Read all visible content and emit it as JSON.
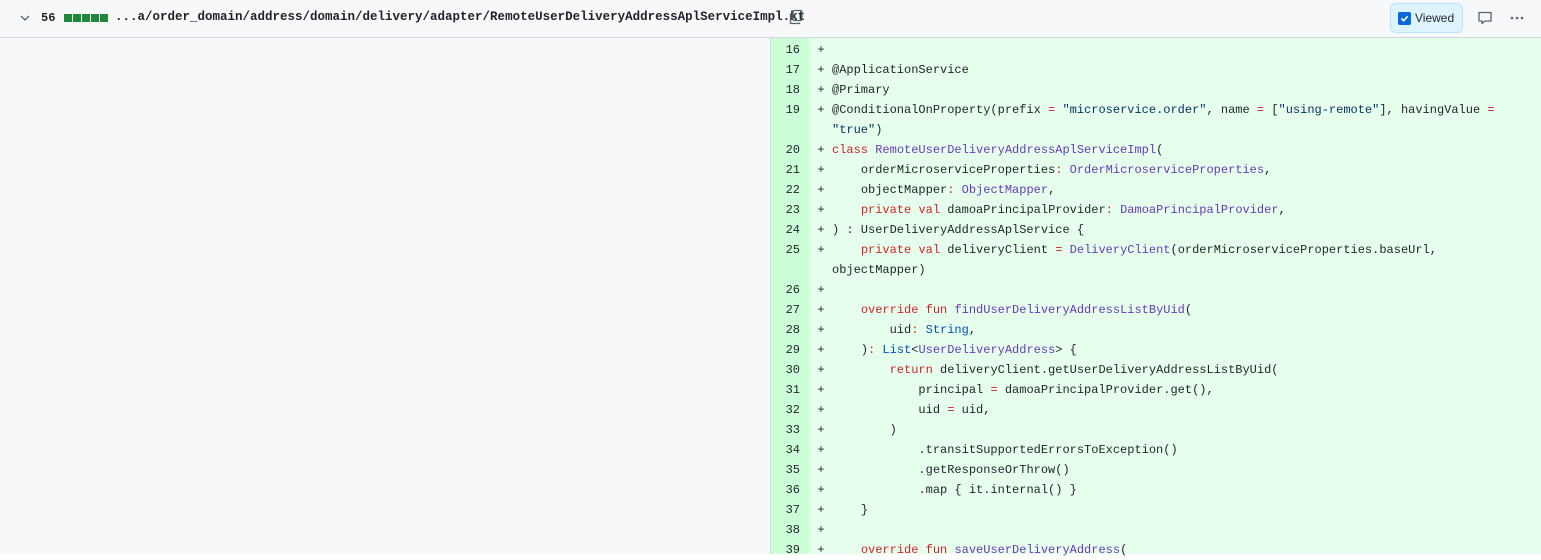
{
  "file_header": {
    "changes_count": "56",
    "file_path": "...a/order_domain/address/domain/delivery/adapter/RemoteUserDeliveryAddressAplServiceImpl.kt",
    "viewed_label": "Viewed",
    "viewed_checked": true,
    "diffstat_added_blocks": 5
  },
  "colors": {
    "added_bg": "#e6ffec",
    "added_gutter": "#ccffd8",
    "keyword": "#cf222e",
    "type": "#6639ba",
    "string": "#0a3069",
    "builtin": "#0550ae"
  },
  "diff_lines": [
    {
      "num": "16",
      "sign": "+",
      "tokens": []
    },
    {
      "num": "17",
      "sign": "+",
      "tokens": [
        [
          "@ApplicationService",
          ""
        ]
      ]
    },
    {
      "num": "18",
      "sign": "+",
      "tokens": [
        [
          "@Primary",
          ""
        ]
      ]
    },
    {
      "num": "19",
      "sign": "+",
      "tokens": [
        [
          "@ConditionalOnProperty(prefix ",
          ""
        ],
        [
          "=",
          "k"
        ],
        [
          " ",
          ""
        ],
        [
          "\"microservice.order\"",
          "s"
        ],
        [
          ", name ",
          ""
        ],
        [
          "=",
          "k"
        ],
        [
          " [",
          ""
        ],
        [
          "\"using-remote\"",
          "s"
        ],
        [
          "], havingValue ",
          ""
        ],
        [
          "=",
          "k"
        ],
        [
          " ",
          ""
        ],
        [
          "\"true\"",
          "s"
        ],
        [
          ")",
          ""
        ]
      ]
    },
    {
      "num": "20",
      "sign": "+",
      "tokens": [
        [
          "class",
          "k"
        ],
        [
          " ",
          ""
        ],
        [
          "RemoteUserDeliveryAddressAplServiceImpl",
          "t"
        ],
        [
          "(",
          ""
        ]
      ]
    },
    {
      "num": "21",
      "sign": "+",
      "tokens": [
        [
          "    orderMicroserviceProperties",
          ""
        ],
        [
          ":",
          "k"
        ],
        [
          " ",
          ""
        ],
        [
          "OrderMicroserviceProperties",
          "t"
        ],
        [
          ",",
          ""
        ]
      ]
    },
    {
      "num": "22",
      "sign": "+",
      "tokens": [
        [
          "    objectMapper",
          ""
        ],
        [
          ":",
          "k"
        ],
        [
          " ",
          ""
        ],
        [
          "ObjectMapper",
          "t"
        ],
        [
          ",",
          ""
        ]
      ]
    },
    {
      "num": "23",
      "sign": "+",
      "tokens": [
        [
          "    ",
          ""
        ],
        [
          "private",
          "k"
        ],
        [
          " ",
          ""
        ],
        [
          "val",
          "k"
        ],
        [
          " damoaPrincipalProvider",
          ""
        ],
        [
          ":",
          "k"
        ],
        [
          " ",
          ""
        ],
        [
          "DamoaPrincipalProvider",
          "t"
        ],
        [
          ",",
          ""
        ]
      ]
    },
    {
      "num": "24",
      "sign": "+",
      "tokens": [
        [
          ") : UserDeliveryAddressAplService {",
          ""
        ]
      ]
    },
    {
      "num": "25",
      "sign": "+",
      "tokens": [
        [
          "    ",
          ""
        ],
        [
          "private",
          "k"
        ],
        [
          " ",
          ""
        ],
        [
          "val",
          "k"
        ],
        [
          " deliveryClient ",
          ""
        ],
        [
          "=",
          "k"
        ],
        [
          " ",
          ""
        ],
        [
          "DeliveryClient",
          "t"
        ],
        [
          "(orderMicroserviceProperties.baseUrl, objectMapper)",
          ""
        ]
      ]
    },
    {
      "num": "26",
      "sign": "+",
      "tokens": []
    },
    {
      "num": "27",
      "sign": "+",
      "tokens": [
        [
          "    ",
          ""
        ],
        [
          "override",
          "k"
        ],
        [
          " ",
          ""
        ],
        [
          "fun",
          "k"
        ],
        [
          " ",
          ""
        ],
        [
          "findUserDeliveryAddressListByUid",
          "t"
        ],
        [
          "(",
          ""
        ]
      ]
    },
    {
      "num": "28",
      "sign": "+",
      "tokens": [
        [
          "        uid",
          ""
        ],
        [
          ":",
          "k"
        ],
        [
          " ",
          ""
        ],
        [
          "String",
          "b"
        ],
        [
          ",",
          ""
        ]
      ]
    },
    {
      "num": "29",
      "sign": "+",
      "tokens": [
        [
          "    )",
          ""
        ],
        [
          ":",
          "k"
        ],
        [
          " ",
          ""
        ],
        [
          "List",
          "b"
        ],
        [
          "<",
          ""
        ],
        [
          "UserDeliveryAddress",
          "t"
        ],
        [
          "> {",
          ""
        ]
      ]
    },
    {
      "num": "30",
      "sign": "+",
      "tokens": [
        [
          "        ",
          ""
        ],
        [
          "return",
          "k"
        ],
        [
          " deliveryClient.getUserDeliveryAddressListByUid(",
          ""
        ]
      ]
    },
    {
      "num": "31",
      "sign": "+",
      "tokens": [
        [
          "            principal ",
          ""
        ],
        [
          "=",
          "k"
        ],
        [
          " damoaPrincipalProvider.get(),",
          ""
        ]
      ]
    },
    {
      "num": "32",
      "sign": "+",
      "tokens": [
        [
          "            uid ",
          ""
        ],
        [
          "=",
          "k"
        ],
        [
          " uid,",
          ""
        ]
      ]
    },
    {
      "num": "33",
      "sign": "+",
      "tokens": [
        [
          "        )",
          ""
        ]
      ]
    },
    {
      "num": "34",
      "sign": "+",
      "tokens": [
        [
          "            .transitSupportedErrorsToException()",
          ""
        ]
      ]
    },
    {
      "num": "35",
      "sign": "+",
      "tokens": [
        [
          "            .getResponseOrThrow()",
          ""
        ]
      ]
    },
    {
      "num": "36",
      "sign": "+",
      "tokens": [
        [
          "            .map { it.internal() }",
          ""
        ]
      ]
    },
    {
      "num": "37",
      "sign": "+",
      "tokens": [
        [
          "    }",
          ""
        ]
      ]
    },
    {
      "num": "38",
      "sign": "+",
      "tokens": []
    },
    {
      "num": "39",
      "sign": "+",
      "tokens": [
        [
          "    ",
          ""
        ],
        [
          "override",
          "k"
        ],
        [
          " ",
          ""
        ],
        [
          "fun",
          "k"
        ],
        [
          " ",
          ""
        ],
        [
          "saveUserDeliveryAddress",
          "t"
        ],
        [
          "(",
          ""
        ]
      ]
    }
  ]
}
